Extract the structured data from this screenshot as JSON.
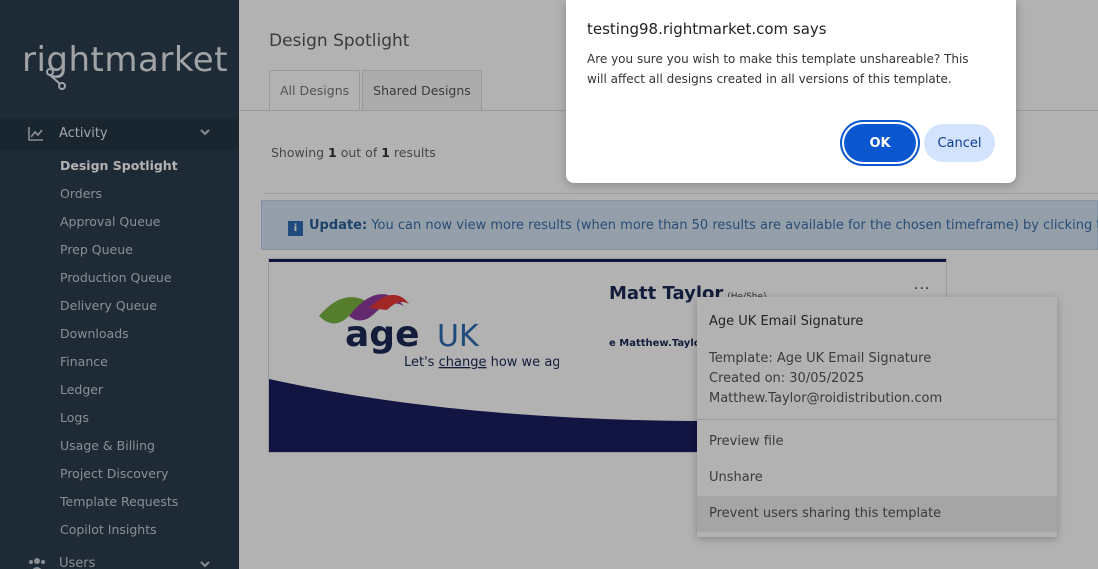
{
  "sidebar": {
    "logo_text": "rightmarket",
    "activity_label": "Activity",
    "items": [
      {
        "label": "Design Spotlight",
        "active": true
      },
      {
        "label": "Orders"
      },
      {
        "label": "Approval Queue"
      },
      {
        "label": "Prep Queue"
      },
      {
        "label": "Production Queue"
      },
      {
        "label": "Delivery Queue"
      },
      {
        "label": "Downloads"
      },
      {
        "label": "Finance"
      },
      {
        "label": "Ledger"
      },
      {
        "label": "Logs"
      },
      {
        "label": "Usage & Billing"
      },
      {
        "label": "Project Discovery"
      },
      {
        "label": "Template Requests"
      },
      {
        "label": "Copilot Insights"
      }
    ],
    "users_label": "Users"
  },
  "main": {
    "title": "Design Spotlight",
    "tabs": [
      {
        "label": "All Designs"
      },
      {
        "label": "Shared Designs",
        "active": true
      }
    ],
    "results": {
      "prefix": "Showing",
      "count": "1",
      "middle": "out of",
      "total": "1",
      "suffix": "results"
    },
    "notice": {
      "bold": "Update:",
      "text": "You can now view more results (when more than 50 results are available for the chosen timeframe) by clicking the"
    }
  },
  "card": {
    "logo_main": "age",
    "logo_uk": "UK",
    "logo_tag1": "Let's",
    "logo_tag2": "change",
    "logo_tag3": "how we age",
    "sig_name": "Matt Taylor",
    "sig_pronoun": "(He/She)",
    "sig_email": "e Matthew.Taylor",
    "dots": "..."
  },
  "menu": {
    "title": "Age UK Email Signature",
    "template": "Template: Age UK Email Signature",
    "created": "Created on: 30/05/2025",
    "email": "Matthew.Taylor@roidistribution.com",
    "items": [
      {
        "label": "Preview file"
      },
      {
        "label": "Unshare"
      },
      {
        "label": "Prevent users sharing this template"
      }
    ]
  },
  "dialog": {
    "title": "testing98.rightmarket.com says",
    "message": "Are you sure you wish to make this template unshareable? This will affect all designs created in all versions of this template.",
    "ok_label": "OK",
    "cancel_label": "Cancel"
  },
  "colors": {
    "sidebar_bg": "#2c3e50",
    "accent": "#0b57d0",
    "ageuk_navy": "#1a1d5e"
  }
}
